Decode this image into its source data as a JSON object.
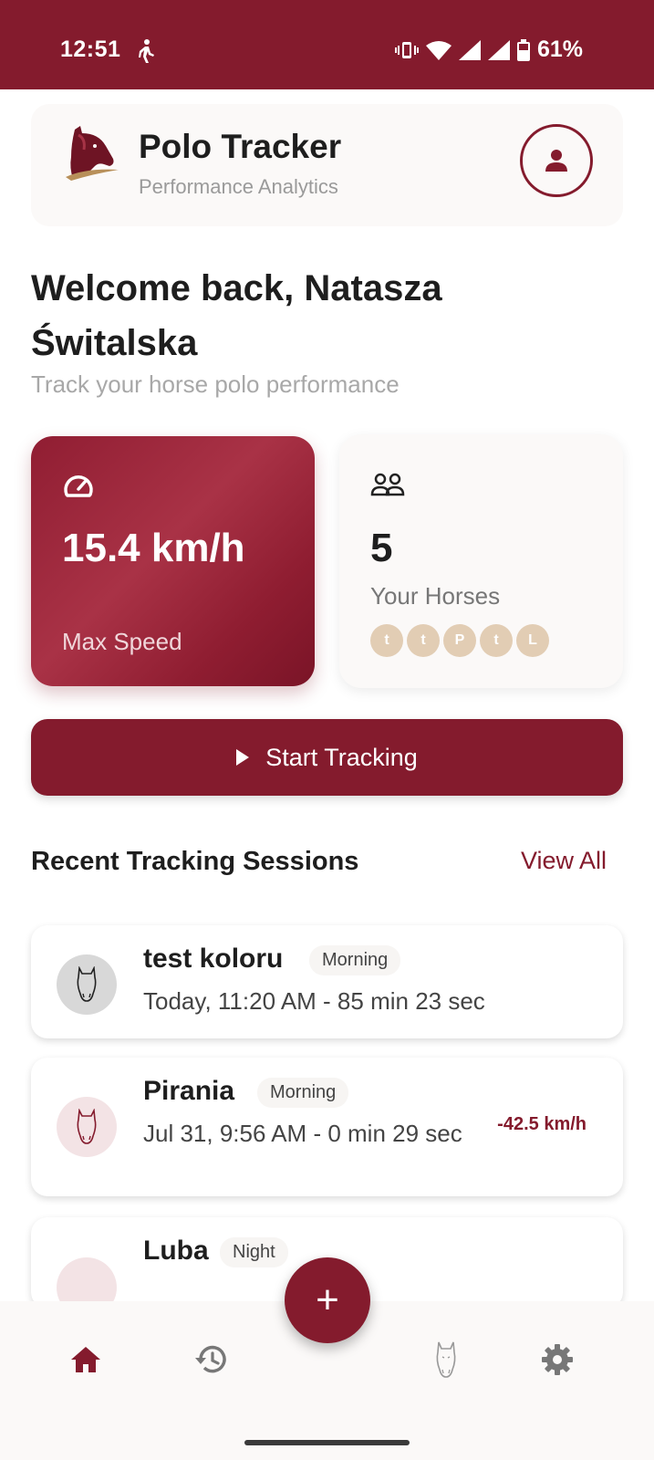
{
  "status_bar": {
    "time": "12:51",
    "battery": "61%",
    "icons": [
      "walk-icon",
      "vibrate-icon",
      "wifi-icon",
      "signal-icon",
      "signal-icon",
      "battery-icon"
    ]
  },
  "header": {
    "title": "Polo Tracker",
    "subtitle": "Performance Analytics",
    "logo_icon": "horse-head-logo",
    "profile_icon": "person-icon"
  },
  "welcome": {
    "title": "Welcome back, Natasza Świtalska",
    "subtitle": "Track your horse polo performance"
  },
  "stats": {
    "speed": {
      "value": "15.4 km/h",
      "label": "Max Speed",
      "icon": "speedometer-icon"
    },
    "horses": {
      "value": "5",
      "label": "Your Horses",
      "icon": "group-icon",
      "avatars": [
        "t",
        "t",
        "P",
        "t",
        "L"
      ]
    }
  },
  "start_button": {
    "label": "Start Tracking",
    "icon": "play-icon"
  },
  "recent": {
    "title": "Recent Tracking Sessions",
    "view_all": "View All",
    "sessions": [
      {
        "name": "test koloru",
        "badge": "Morning",
        "detail": "Today, 11:20 AM - 85 min 23 sec",
        "speed": ""
      },
      {
        "name": "Pirania",
        "badge": "Morning",
        "detail": "Jul 31, 9:56 AM - 0 min 29 sec",
        "speed": "-42.5 km/h"
      },
      {
        "name": "Luba",
        "badge": "Night",
        "detail": "",
        "speed": ""
      }
    ]
  },
  "fab": {
    "label": "+"
  },
  "nav": {
    "items": [
      "home-icon",
      "history-icon",
      "horse-icon",
      "settings-icon"
    ],
    "active": "home-icon"
  },
  "colors": {
    "primary": "#841b2d",
    "avatar_chip": "#e2cdb4",
    "card_bg": "#fbf9f8"
  }
}
